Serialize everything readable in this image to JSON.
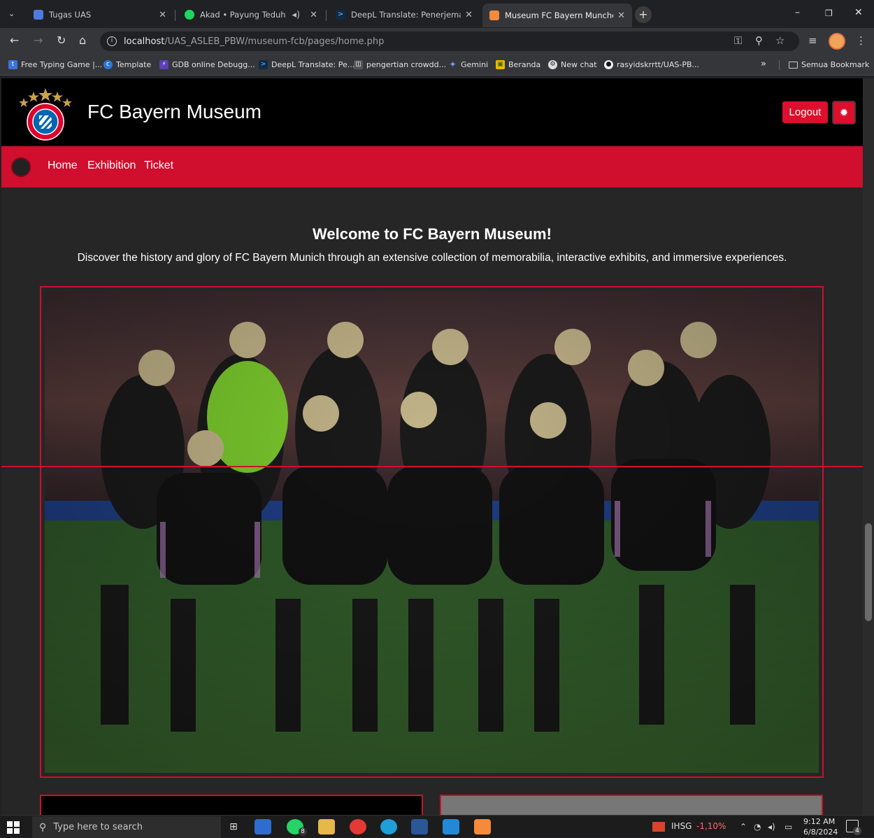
{
  "browser": {
    "tabs": [
      {
        "title": "Tugas UAS",
        "color": "#4f7be0"
      },
      {
        "title": "Akad • Payung Teduh",
        "color": "#1ed760"
      },
      {
        "title": "DeepL Translate: Penerjemah pa",
        "color": "#0f2b46"
      },
      {
        "title": "Museum FC Bayern Munchen",
        "color": "#f58a3b"
      }
    ],
    "url_host": "localhost",
    "url_path": "/UAS_ASLEB_PBW/museum-fcb/pages/home.php",
    "bookmarks": [
      "Free Typing Game |...",
      "Template",
      "GDB online Debugg...",
      "DeepL Translate: Pe...",
      "pengertian crowdd...",
      "Gemini",
      "Beranda",
      "New chat",
      "rasyidskrrtt/UAS-PB..."
    ],
    "bookmarks_overflow": "»",
    "bookmarks_folder": "Semua Bookmark"
  },
  "site": {
    "title": "FC Bayern Museum",
    "logout_label": "Logout",
    "nav": [
      "Home",
      "Exhibition",
      "Ticket"
    ],
    "welcome_title": "Welcome to FC Bayern Museum!",
    "welcome_text": "Discover the history and glory of FC Bayern Munich through an extensive collection of memorabilia, interactive exhibits, and immersive experiences.",
    "colors": {
      "primary": "#cf0f2d",
      "header_bg": "#000000",
      "page_bg": "#262626"
    }
  },
  "taskbar": {
    "search_placeholder": "Type here to search",
    "ticker": "IHSG",
    "ticker_change": "-1,10%",
    "time": "9:12 AM",
    "date": "6/8/2024",
    "notification_count": "4",
    "whatsapp_badge": "8"
  }
}
